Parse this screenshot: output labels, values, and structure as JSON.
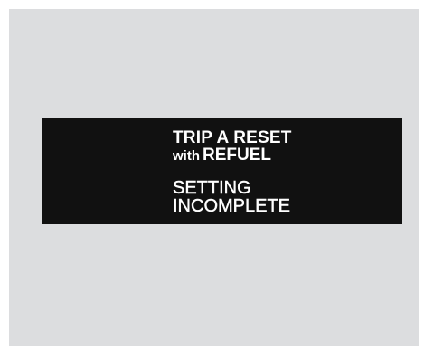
{
  "display": {
    "line1": "TRIP A RESET",
    "line2_prefix": "with",
    "line2_main": "REFUEL",
    "line3": "SETTING",
    "line4": "INCOMPLETE"
  },
  "colors": {
    "background": "#dcdddf",
    "display_background": "#111111",
    "display_text": "#ffffff"
  }
}
